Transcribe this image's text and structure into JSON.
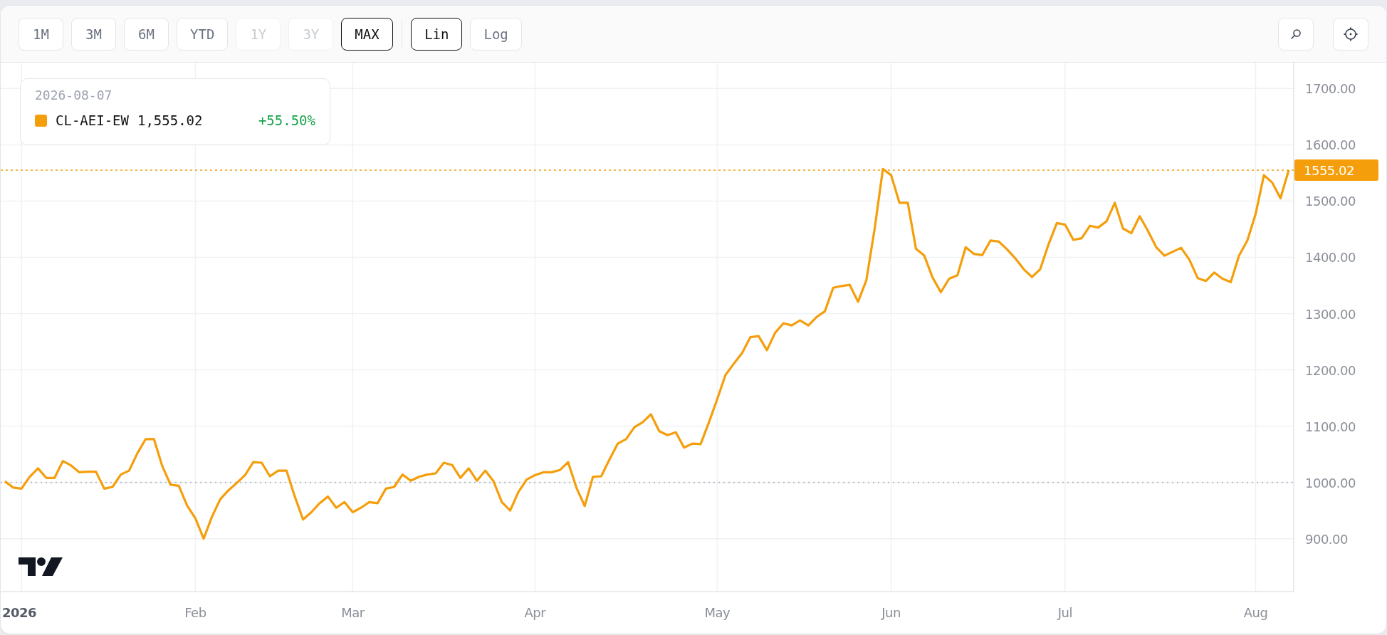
{
  "toolbar": {
    "ranges": [
      {
        "label": "1M",
        "selected": false,
        "disabled": false
      },
      {
        "label": "3M",
        "selected": false,
        "disabled": false
      },
      {
        "label": "6M",
        "selected": false,
        "disabled": false
      },
      {
        "label": "YTD",
        "selected": false,
        "disabled": false
      },
      {
        "label": "1Y",
        "selected": false,
        "disabled": true
      },
      {
        "label": "3Y",
        "selected": false,
        "disabled": true
      },
      {
        "label": "MAX",
        "selected": true,
        "disabled": false
      }
    ],
    "scales": [
      {
        "label": "Lin",
        "selected": true
      },
      {
        "label": "Log",
        "selected": false
      }
    ]
  },
  "chart": {
    "legend": {
      "date": "2026-08-07",
      "value": "1,555.02",
      "change": "+55.50%"
    },
    "chart_data": {
      "type": "line",
      "categories": [
        null,
        null,
        "2026",
        null,
        null,
        null,
        null,
        null,
        null,
        null,
        null,
        null,
        null,
        null,
        null,
        null,
        null,
        null,
        null,
        null,
        null,
        null,
        null,
        "Feb",
        null,
        null,
        null,
        null,
        null,
        null,
        null,
        null,
        null,
        null,
        null,
        null,
        null,
        null,
        null,
        null,
        null,
        null,
        "Mar",
        null,
        null,
        null,
        null,
        null,
        null,
        null,
        null,
        null,
        null,
        null,
        null,
        null,
        null,
        null,
        null,
        null,
        null,
        null,
        null,
        null,
        "Apr",
        null,
        null,
        null,
        null,
        null,
        null,
        null,
        null,
        null,
        null,
        null,
        null,
        null,
        null,
        null,
        null,
        null,
        null,
        null,
        null,
        null,
        "May",
        null,
        null,
        null,
        null,
        null,
        null,
        null,
        null,
        null,
        null,
        null,
        null,
        null,
        null,
        null,
        null,
        null,
        null,
        null,
        null,
        "Jun",
        null,
        null,
        null,
        null,
        null,
        null,
        null,
        null,
        null,
        null,
        null,
        null,
        null,
        null,
        null,
        null,
        null,
        null,
        null,
        null,
        "Jul",
        null,
        null,
        null,
        null,
        null,
        null,
        null,
        null,
        null,
        null,
        null,
        null,
        null,
        null,
        null,
        null,
        null,
        null,
        null,
        null,
        null,
        null,
        "Aug",
        null,
        null,
        null,
        null
      ],
      "series": [
        {
          "name": "CL-AEI-EW",
          "color": "#f59e0b",
          "values": [
            1002,
            991,
            989,
            1010,
            1025,
            1008,
            1008,
            1038,
            1030,
            1018,
            1019,
            1019,
            989,
            992,
            1014,
            1021,
            1052,
            1077,
            1077,
            1029,
            996,
            994,
            959,
            936,
            900,
            939,
            970,
            986,
            999,
            1013,
            1036,
            1035,
            1011,
            1021,
            1021,
            975,
            934,
            947,
            963,
            975,
            955,
            965,
            947,
            955,
            965,
            963,
            989,
            992,
            1014,
            1003,
            1010,
            1014,
            1016,
            1035,
            1031,
            1008,
            1025,
            1003,
            1021,
            1002,
            965,
            950,
            983,
            1005,
            1013,
            1018,
            1018,
            1022,
            1036,
            991,
            958,
            1010,
            1011,
            1041,
            1069,
            1077,
            1098,
            1107,
            1121,
            1091,
            1084,
            1089,
            1062,
            1069,
            1068,
            1107,
            1148,
            1191,
            1211,
            1230,
            1258,
            1260,
            1235,
            1266,
            1283,
            1279,
            1288,
            1279,
            1294,
            1304,
            1346,
            1349,
            1351,
            1321,
            1359,
            1450,
            1557,
            1546,
            1497,
            1497,
            1415,
            1403,
            1364,
            1338,
            1362,
            1368,
            1418,
            1406,
            1404,
            1430,
            1428,
            1414,
            1398,
            1379,
            1365,
            1379,
            1423,
            1461,
            1458,
            1431,
            1434,
            1456,
            1453,
            1464,
            1497,
            1451,
            1443,
            1473,
            1447,
            1418,
            1403,
            1410,
            1417,
            1396,
            1363,
            1358,
            1373,
            1362,
            1356,
            1403,
            1430,
            1477,
            1546,
            1533,
            1505,
            1555
          ]
        }
      ],
      "ylim": [
        806,
        1746
      ],
      "grid": true,
      "yticks": [
        {
          "value": 900,
          "label": "900.00"
        },
        {
          "value": 1000,
          "label": "1000.00"
        },
        {
          "value": 1100,
          "label": "1100.00"
        },
        {
          "value": 1200,
          "label": "1200.00"
        },
        {
          "value": 1300,
          "label": "1300.00"
        },
        {
          "value": 1400,
          "label": "1400.00"
        },
        {
          "value": 1500,
          "label": "1500.00"
        },
        {
          "value": 1600,
          "label": "1600.00"
        },
        {
          "value": 1700,
          "label": "1700.00"
        }
      ],
      "ref_lines": [
        {
          "axis": "y",
          "value": 1000,
          "color": "#b8bcc4"
        },
        {
          "axis": "y",
          "value": 1555.02,
          "label": "1555.02",
          "color": "#f59e0b"
        }
      ]
    }
  }
}
